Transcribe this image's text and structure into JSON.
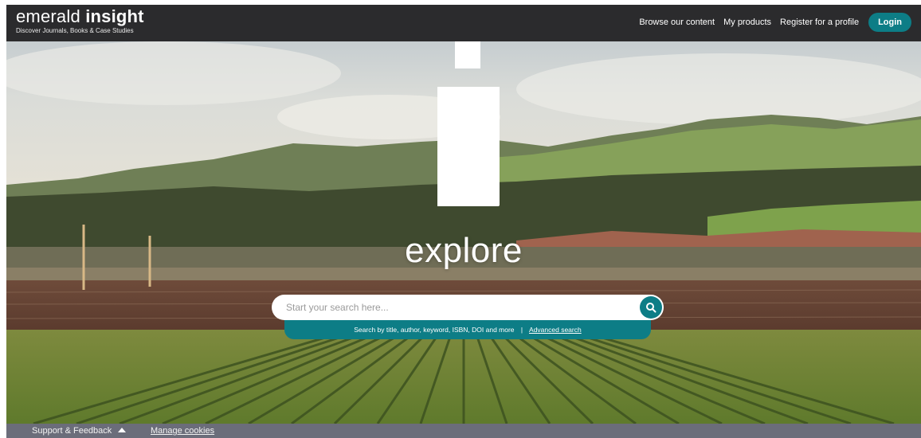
{
  "header": {
    "logo_light": "emerald",
    "logo_bold": "insight",
    "logo_tagline": "Discover Journals, Books & Case Studies",
    "nav": [
      {
        "label": "Browse our content"
      },
      {
        "label": "My products"
      },
      {
        "label": "Register for a profile"
      }
    ],
    "login_label": "Login"
  },
  "hero": {
    "heading": "explore",
    "search_placeholder": "Start your search here...",
    "search_help": "Search by title, author, keyword, ISBN, DOI and more",
    "separator": "|",
    "advanced_search": "Advanced search"
  },
  "footer": {
    "support_label": "Support & Feedback",
    "cookies_label": "Manage cookies"
  },
  "colors": {
    "header_bg": "#2b2b2d",
    "accent": "#0d7d86",
    "footer_bg": "#6b6d7a"
  },
  "icons": [
    "search-icon",
    "caret-up-icon",
    "i-logo-graphic"
  ]
}
